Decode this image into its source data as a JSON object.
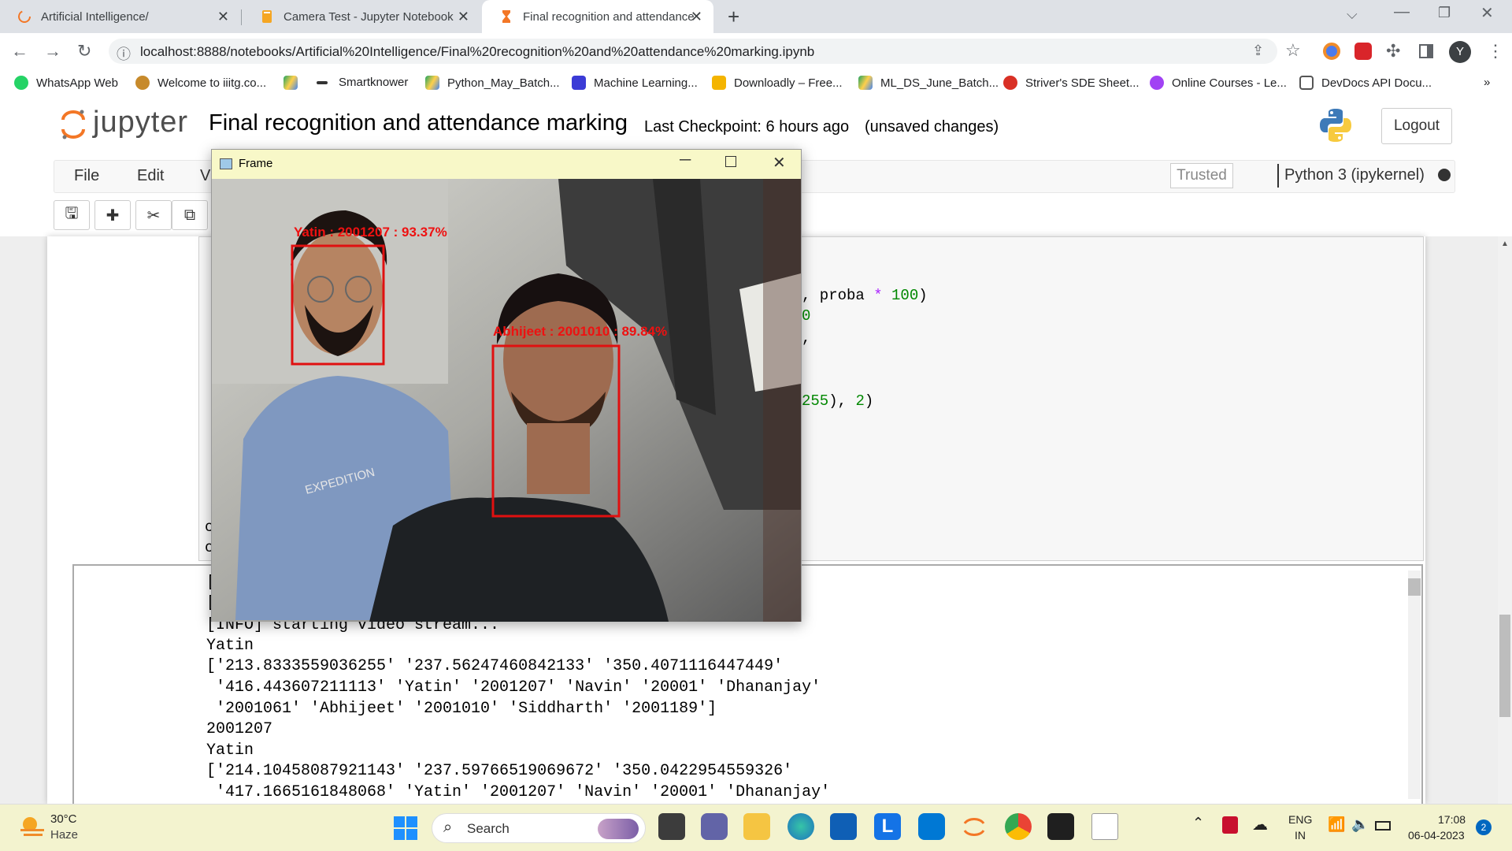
{
  "browser": {
    "tabs": [
      {
        "label": "Artificial Intelligence/",
        "icon": "jupyter-loading-icon"
      },
      {
        "label": "Camera Test - Jupyter Notebook",
        "icon": "notebook-icon"
      },
      {
        "label": "Final recognition and attendance",
        "icon": "hourglass-icon",
        "active": true
      }
    ],
    "url": "localhost:8888/notebooks/Artificial%20Intelligence/Final%20recognition%20and%20attendance%20marking.ipynb",
    "profile_initial": "Y",
    "bookmarks": [
      {
        "label": "WhatsApp Web",
        "color": "#25d366"
      },
      {
        "label": "Welcome to iiitg.co...",
        "color": "#c78a2b"
      },
      {
        "label": "",
        "color": "#1fa463"
      },
      {
        "label": "Smartknower",
        "color": "#333333"
      },
      {
        "label": "Python_May_Batch...",
        "color": "#4285f4"
      },
      {
        "label": "Machine Learning...",
        "color": "#3b3bd6"
      },
      {
        "label": "Downloadly – Free...",
        "color": "#f4b400"
      },
      {
        "label": "ML_DS_June_Batch...",
        "color": "#4285f4"
      },
      {
        "label": "Striver's SDE Sheet...",
        "color": "#d93025"
      },
      {
        "label": "Online Courses - Le...",
        "color": "#a142f4"
      },
      {
        "label": "DevDocs API Docu...",
        "color": "#555555"
      }
    ],
    "more": "»"
  },
  "jupyter": {
    "logo_text": "jupyter",
    "notebook_title": "Final recognition and attendance marking",
    "checkpoint": "Last Checkpoint: 6 hours ago",
    "unsaved": "(unsaved changes)",
    "logout": "Logout",
    "menus": [
      "File",
      "Edit",
      "V"
    ],
    "trusted": "Trusted",
    "kernel": "Python 3 (ipykernel)"
  },
  "code_fragments": [
    {
      "text": ", proba ",
      "op": "*",
      "num": "100",
      "tail": ")"
    },
    {
      "text": "0"
    },
    {
      "text": ","
    },
    {
      "num": "255",
      "tail": "), ",
      "num2": "2",
      "tail2": ")"
    }
  ],
  "code_left_chars": [
    "c",
    "c"
  ],
  "output_lines": [
    "[",
    "[",
    "[INFO] starting video stream...",
    "Yatin",
    "['213.8333559036255' '237.56247460842133' '350.4071116447449'",
    " '416.443607211113' 'Yatin' '2001207' 'Navin' '20001' 'Dhananjay'",
    " '2001061' 'Abhijeet' '2001010' 'Siddharth' '2001189']",
    "2001207",
    "Yatin",
    "['214.10458087921143' '237.59766519069672' '350.0422954559326'",
    " '417.1665161848068' 'Yatin' '2001207' 'Navin' '20001' 'Dhananjay'"
  ],
  "frame": {
    "title": "Frame",
    "labels": [
      "Yatin : 2001207 : 93.37%",
      "Abhijeet : 2001010 : 89.84%"
    ]
  },
  "taskbar": {
    "temp": "30°C",
    "weather": "Haze",
    "search": "Search",
    "lang1": "ENG",
    "lang2": "IN",
    "time": "17:08",
    "date": "06-04-2023",
    "notif": "2"
  }
}
